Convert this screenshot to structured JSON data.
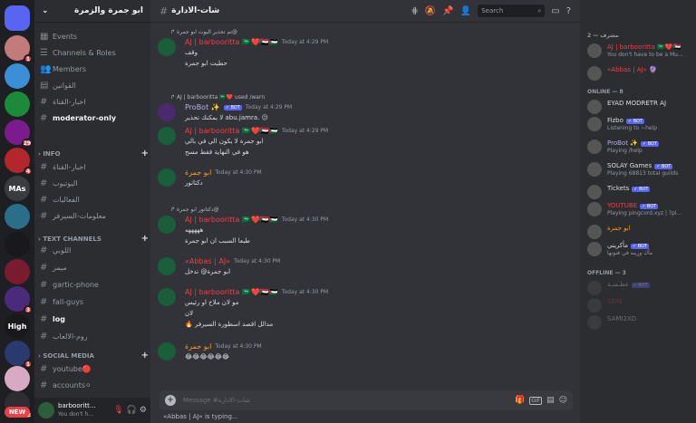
{
  "server": {
    "name": "ابو جمرة والزمرة"
  },
  "guilds": [
    {
      "color": "#5865f2",
      "badge": ""
    },
    {
      "color": "#c27a7a",
      "badge": "1"
    },
    {
      "color": "#3a8fd6",
      "badge": ""
    },
    {
      "color": "#1b8a3b",
      "badge": ""
    },
    {
      "color": "#7b1c8e",
      "badge": "29"
    },
    {
      "color": "#b3262c",
      "badge": "4"
    },
    {
      "color": "#3a3c42",
      "badge": "",
      "label": "MAs"
    },
    {
      "color": "#2a6e8a",
      "badge": ""
    },
    {
      "color": "#19191c",
      "badge": ""
    },
    {
      "color": "#7a1c2f",
      "badge": ""
    },
    {
      "color": "#4a2a7a",
      "badge": "3"
    },
    {
      "color": "#19191c",
      "badge": "",
      "label": "High"
    },
    {
      "color": "#2a3a6e",
      "badge": "1"
    },
    {
      "color": "#d7a9c2",
      "badge": ""
    },
    {
      "color": "#2d2d33",
      "badge": "12"
    }
  ],
  "new_label": "NEW",
  "channels": {
    "top": [
      {
        "icon": "calendar-icon",
        "label": "Events"
      },
      {
        "icon": "channels-icon",
        "label": "Channels & Roles"
      },
      {
        "icon": "members-icon",
        "label": "Members"
      },
      {
        "icon": "rules-icon",
        "label": "القوانين"
      },
      {
        "icon": "hash",
        "label": "اخبار-القناة"
      },
      {
        "icon": "hash",
        "label": "moderator-only"
      }
    ],
    "info_category": "INFO",
    "info": [
      "اخبار-القناة",
      "اليوتيوب",
      "الفعاليات",
      "معلومات-السيرفر"
    ],
    "text_category": "TEXT CHANNELS",
    "text": [
      "اللوبي",
      "ميمز",
      "gartic-phone",
      "fall-guys",
      "log",
      "روم-الالعاب"
    ],
    "social_category": "SOCIAL MEDIA",
    "social": [
      "youtube🔴",
      "accounts⚪"
    ]
  },
  "user": {
    "name": "barbooritt...",
    "status": "You don't h..."
  },
  "channel_title": "شات-الادارة",
  "search_placeholder": "Search",
  "messages": [
    {
      "reply": "تم تحذير اليوت ابو جمرة@",
      "name": "AJ | barbooritta 🇸🇦❤️🇸🇩🇵🇸",
      "time": "Today at 4:29 PM",
      "lines": [
        "وقف",
        "حطيت ابو جمرة"
      ]
    },
    {
      "reply": "AJ | barbooritta 🇸🇦❤️ used /warn",
      "name": "ProBot ✨",
      "bot": "BOT",
      "time": "Today at 4:29 PM",
      "lines": [
        "لا يمكنك تحذير abu.jamra. 😕"
      ]
    },
    {
      "name": "AJ | barbooritta 🇸🇦❤️🇸🇩🇵🇸",
      "time": "Today at 4:29 PM",
      "lines": [
        "ابو جمرة لا يكون الي في بالي",
        "هو في النهاية فقط مسح"
      ]
    },
    {
      "name": "ابو جمرة",
      "time": "Today at 4:30 PM",
      "lines": [
        "دكتاتور"
      ]
    },
    {
      "reply": "دكتاتور ابو جمرة@",
      "name": "AJ | barbooritta 🇸🇦❤️🇸🇩🇵🇸",
      "time": "Today at 4:30 PM",
      "lines": [
        "هههههه",
        "طبعا السبب ان ابو جمرة"
      ]
    },
    {
      "name": "«Abbas | AJ»",
      "time": "Today at 4:30 PM",
      "lines": [
        "ابو جمرة@ تدخل"
      ]
    },
    {
      "name": "AJ | barbooritta 🇸🇦❤️🇸🇩🇵🇸",
      "time": "Today at 4:30 PM",
      "lines": [
        "مو لان ملاخ او رئيس",
        "لان",
        "🔥 مدالل اقصد اسطورة السيرفر"
      ]
    },
    {
      "name": "ابو جمرة",
      "time": "Today at 4:30 PM",
      "lines": [
        "😂😂😂😂😂😂"
      ]
    }
  ],
  "composer_placeholder": "Message #شات-الادارة",
  "composer_buttons": [
    "gift-icon",
    "GIF",
    "sticker-icon",
    "emoji-icon"
  ],
  "typing_text": "«Abbas | AJ» is typing...",
  "member_groups": [
    {
      "title": "مشرف — 2",
      "members": [
        {
          "name": "AJ | barbooritta 🇸🇦❤️🇸🇩",
          "status": "You don't have to be a Mu...",
          "color": "#f23f43"
        },
        {
          "name": "«Abbas | AJ» 🔮",
          "status": "",
          "color": "#f23f43"
        }
      ]
    },
    {
      "title": "ONLINE — 8",
      "members": [
        {
          "name": "EYAD MODRETR AJ",
          "status": "",
          "color": "#dbdee1"
        },
        {
          "name": "Fizbo",
          "bot": "BOT",
          "status": "Listening to ~help",
          "color": "#dbdee1"
        },
        {
          "name": "ProBot ✨",
          "bot": "BOT",
          "status": "Playing /help",
          "color": "#b5aef0"
        },
        {
          "name": "SOLAY Games",
          "bot": "BOT",
          "status": "Playing 68813 total guilds",
          "color": "#dbdee1"
        },
        {
          "name": "Tickets",
          "bot": "BOT",
          "status": "",
          "color": "#dbdee1"
        },
        {
          "name": "YOUTUBE",
          "bot": "BOT",
          "status": "Playing pingcord.xyz | ?pi...",
          "color": "#f23f43"
        },
        {
          "name": "ابو جمرة",
          "status": "",
          "color": "#fd9a1d"
        },
        {
          "name": "مأكريني",
          "bot": "BOT",
          "status": "مأك وزينه في فنونها",
          "color": "#dbdee1"
        }
      ]
    },
    {
      "title": "OFFLINE — 3",
      "members": [
        {
          "name": "غطـسـة",
          "bot": "BOT",
          "status": "",
          "color": "#dbdee1"
        },
        {
          "name": "SEIN",
          "status": "",
          "color": "#f23f43"
        },
        {
          "name": "SAMI2XD",
          "status": "",
          "color": "#dbdee1"
        }
      ]
    }
  ]
}
